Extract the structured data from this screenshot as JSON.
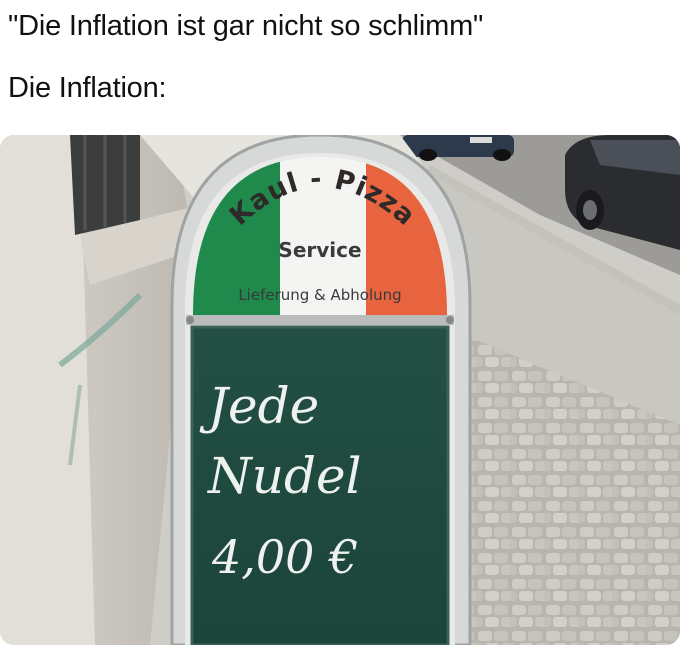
{
  "caption": {
    "line1": "\"Die Inflation ist gar nicht so schlimm\"",
    "line2": "Die Inflation:"
  },
  "sign": {
    "brand": "Kaul - Pizza",
    "service": "Service",
    "delivery": "Lieferung & Abholung",
    "chalk_line1": "Jede",
    "chalk_line2": "Nudel",
    "chalk_line3": "4,00 €"
  },
  "colors": {
    "flag_green": "#1f8a4c",
    "flag_white": "#f4f4f2",
    "flag_red": "#e7643f",
    "chalkboard": "#1f4a40"
  }
}
